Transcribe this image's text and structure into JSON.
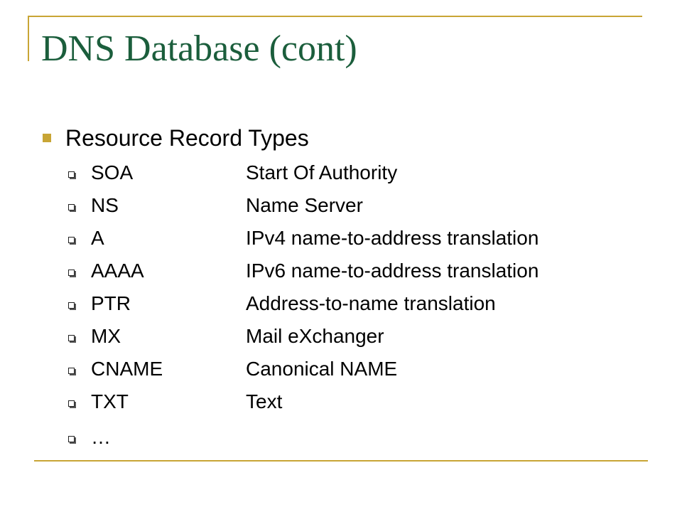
{
  "slide": {
    "title": "DNS Database (cont)",
    "heading": "Resource Record Types",
    "records": [
      {
        "type": "SOA",
        "description": "Start Of Authority"
      },
      {
        "type": "NS",
        "description": "Name Server"
      },
      {
        "type": "A",
        "description": "IPv4 name-to-address translation"
      },
      {
        "type": "AAAA",
        "description": "IPv6 name-to-address translation"
      },
      {
        "type": "PTR",
        "description": "Address-to-name translation"
      },
      {
        "type": "MX",
        "description": "Mail eXchanger"
      },
      {
        "type": "CNAME",
        "description": "Canonical NAME"
      },
      {
        "type": "TXT",
        "description": "Text"
      }
    ],
    "ellipsis": "…"
  },
  "colors": {
    "title": "#1b5e3c",
    "accent": "#c8a535",
    "text": "#000000"
  }
}
